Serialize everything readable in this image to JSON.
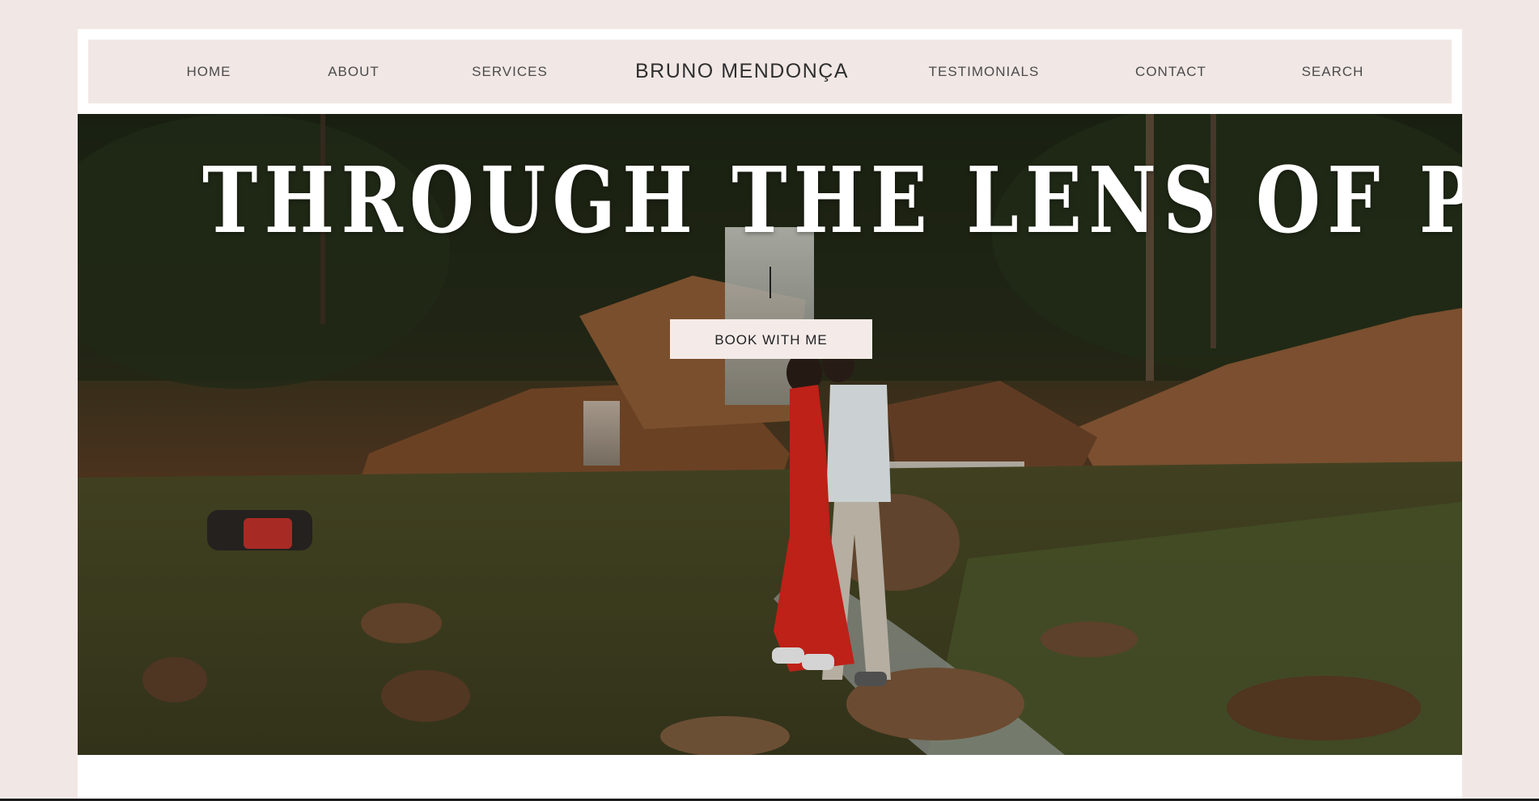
{
  "nav": {
    "home": "HOME",
    "about": "ABOUT",
    "services": "SERVICES",
    "brand": "BRUNO MENDONÇA",
    "testimonials": "TESTIMONIALS",
    "contact": "CONTACT",
    "search": "SEARCH"
  },
  "hero": {
    "title": "THROUGH THE LENS OF PASSION",
    "cta_label": "BOOK WITH ME"
  },
  "colors": {
    "page_background": "#f1e8e5",
    "frame": "#ffffff",
    "nav_text": "#4b4b4b",
    "cta_background": "#f4ebe9",
    "dress_red": "#d8261c"
  }
}
